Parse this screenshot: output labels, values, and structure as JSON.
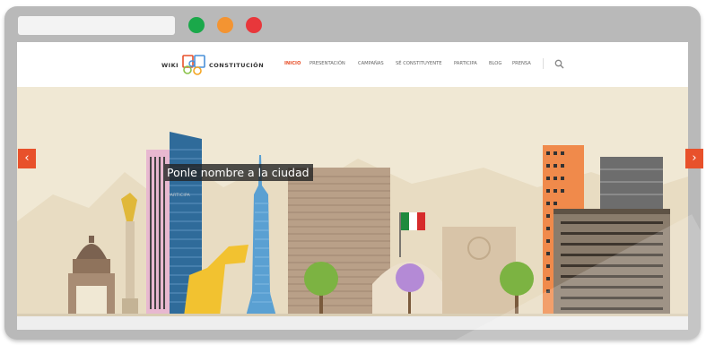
{
  "browser": {
    "window_dots": [
      {
        "name": "green",
        "color": "#1aa84a"
      },
      {
        "name": "orange",
        "color": "#f39432"
      },
      {
        "name": "red",
        "color": "#e8373b"
      }
    ]
  },
  "site": {
    "logo": {
      "word_left": "WIKI",
      "word_right": "CONSTITUCIÓN",
      "icon": "book-icon"
    },
    "menu": [
      {
        "label": "INICIO",
        "active": true
      },
      {
        "label": "PRESENTACIÓN",
        "active": false
      },
      {
        "label": "CAMPAÑAS",
        "active": false
      },
      {
        "label": "SÉ CONSTITUYENTE",
        "active": false
      },
      {
        "label": "PARTICIPA",
        "active": false
      },
      {
        "label": "BLOG",
        "active": false
      },
      {
        "label": "PRENSA",
        "active": false
      }
    ],
    "search_icon": "search-icon",
    "accent_color": "#e8512b"
  },
  "hero": {
    "title": "Ponle nombre a la ciudad",
    "subtitle": "PARTICIPA",
    "prev_icon": "chevron-left-icon",
    "next_icon": "chevron-right-icon",
    "illustration": "Mexico City skyline"
  }
}
